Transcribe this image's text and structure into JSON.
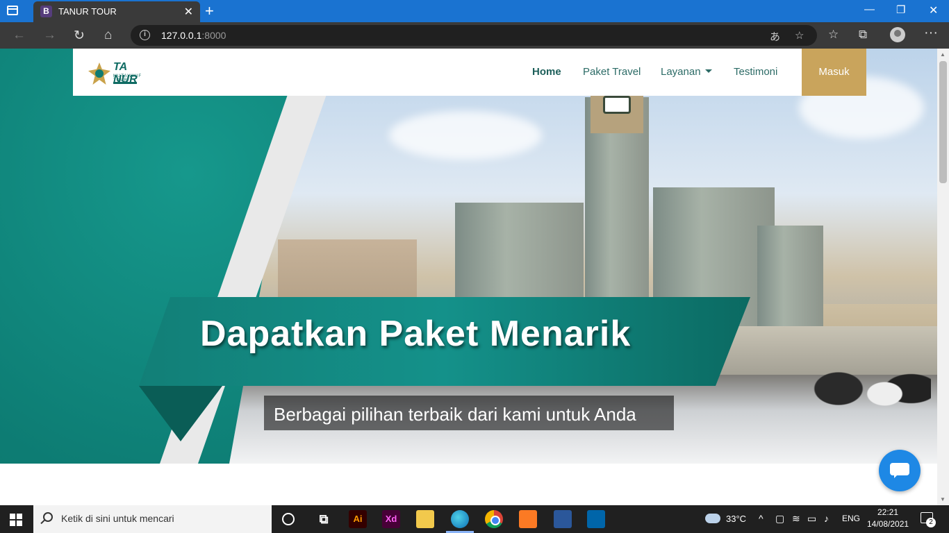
{
  "browser": {
    "tab_title": "TANUR TOUR",
    "tab_favicon_letter": "B",
    "url_host": "127.0.0.1",
    "url_port": ":8000"
  },
  "navbar": {
    "logo_text": "TA NUR",
    "logo_sub": "MUTAWWIF TOUR",
    "links": {
      "home": "Home",
      "paket_travel": "Paket Travel",
      "layanan": "Layanan",
      "testimoni": "Testimoni"
    },
    "login_label": "Masuk"
  },
  "hero": {
    "title": "Dapatkan Paket Menarik",
    "subtitle": "Berbagai pilihan terbaik dari kami untuk Anda"
  },
  "taskbar": {
    "search_placeholder": "Ketik di sini untuk mencari",
    "temperature": "33°C",
    "language": "ENG",
    "time": "22:21",
    "date": "14/08/2021",
    "notification_count": "2",
    "apps": [
      "Ai",
      "Xd"
    ]
  },
  "colors": {
    "brand_teal": "#0f7b72",
    "brand_gold": "#c9a45c",
    "browser_accent": "#1a73d1"
  }
}
